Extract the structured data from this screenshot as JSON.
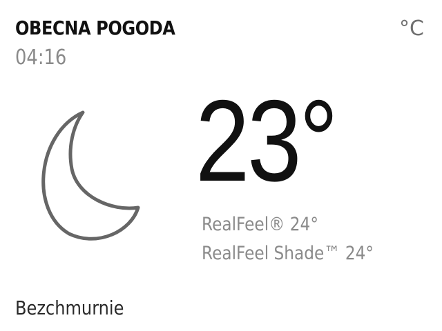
{
  "header": {
    "title": "OBECNA POGODA",
    "time": "04:16",
    "unit": "°C"
  },
  "current": {
    "icon": "moon-icon",
    "temperature": "23°",
    "realfeel": "RealFeel® 24°",
    "realfeel_shade": "RealFeel Shade™ 24°",
    "condition": "Bezchmurnie"
  }
}
